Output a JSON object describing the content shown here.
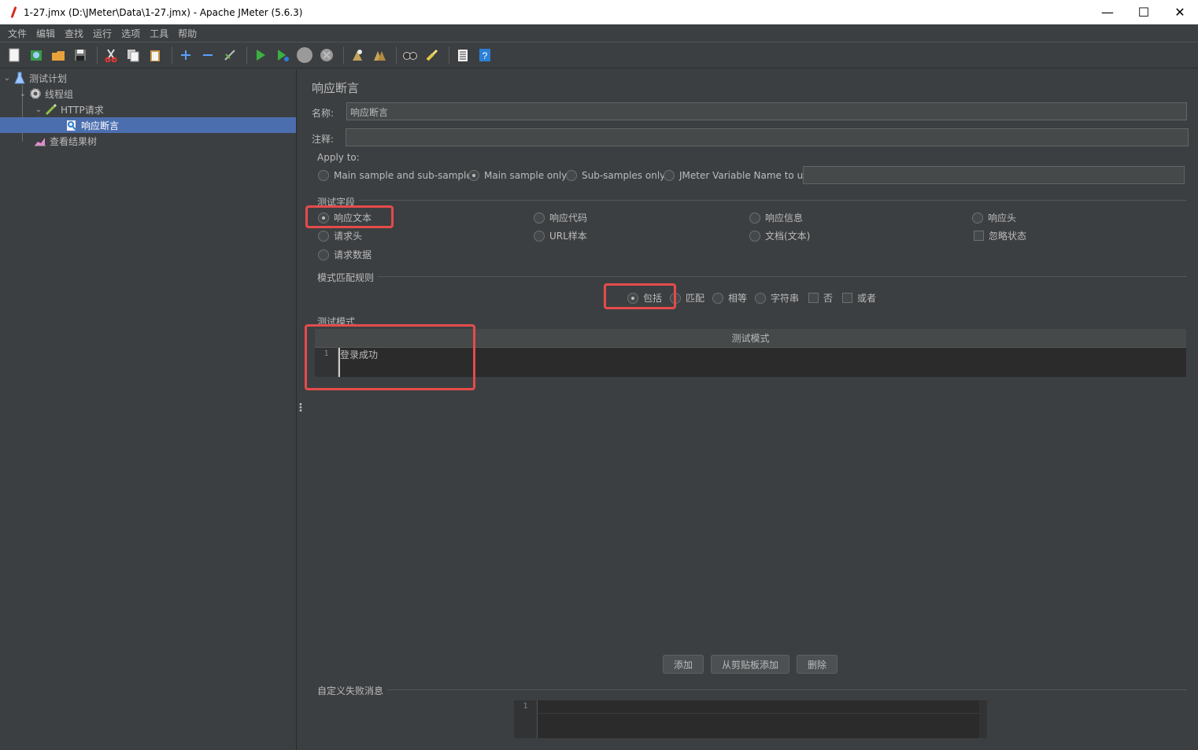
{
  "window": {
    "title": "1-27.jmx (D:\\JMeter\\Data\\1-27.jmx) - Apache JMeter (5.6.3)",
    "minimize": "—",
    "maximize": "☐",
    "close": "✕"
  },
  "menu": [
    "文件",
    "编辑",
    "查找",
    "运行",
    "选项",
    "工具",
    "帮助"
  ],
  "toolbar": {
    "icons": [
      "new-icon",
      "templates-icon",
      "open-icon",
      "save-icon",
      "cut-icon",
      "copy-icon",
      "paste-icon",
      "expand-icon",
      "collapse-icon",
      "toggle-icon",
      "start-icon",
      "start-no-pause-icon",
      "stop-icon",
      "shutdown-icon",
      "clear-icon",
      "clear-all-icon",
      "search-icon",
      "reset-search-icon",
      "function-helper-icon",
      "help-icon"
    ]
  },
  "tree": {
    "items": [
      {
        "label": "测试计划",
        "icon": "test-plan-icon"
      },
      {
        "label": "线程组",
        "icon": "thread-group-icon"
      },
      {
        "label": "HTTP请求",
        "icon": "http-sampler-icon"
      },
      {
        "label": "响应断言",
        "icon": "assertion-icon"
      },
      {
        "label": "查看结果树",
        "icon": "results-tree-icon"
      }
    ]
  },
  "panel": {
    "title": "响应断言",
    "name_label": "名称:",
    "name_value": "响应断言",
    "comment_label": "注释:",
    "comment_value": "",
    "apply_to": {
      "title": "Apply to:",
      "options": [
        "Main sample and sub-samples",
        "Main sample only",
        "Sub-samples only",
        "JMeter Variable Name to use"
      ],
      "selected": "Main sample only",
      "variable_value": ""
    },
    "test_field": {
      "title": "测试字段",
      "options": [
        "响应文本",
        "响应代码",
        "响应信息",
        "响应头",
        "请求头",
        "URL样本",
        "文档(文本)",
        "忽略状态",
        "请求数据"
      ],
      "selected": "响应文本"
    },
    "pattern_rules": {
      "title": "模式匹配规则",
      "options": [
        "包括",
        "匹配",
        "相等",
        "字符串",
        "否",
        "或者"
      ],
      "selected": "包括"
    },
    "test_patterns": {
      "title": "测试模式",
      "column": "测试模式",
      "line_no": "1",
      "rows": [
        "登录成功"
      ]
    },
    "buttons": {
      "add": "添加",
      "add_from_clipboard": "从剪贴板添加",
      "delete": "删除"
    },
    "custom_failure": {
      "title": "自定义失败消息",
      "line_no": "1",
      "value": ""
    }
  },
  "colors": {
    "background": "#3c3f41",
    "selection": "#4b6eaf",
    "highlight": "#e54b4b",
    "text": "#bbbbbb"
  }
}
